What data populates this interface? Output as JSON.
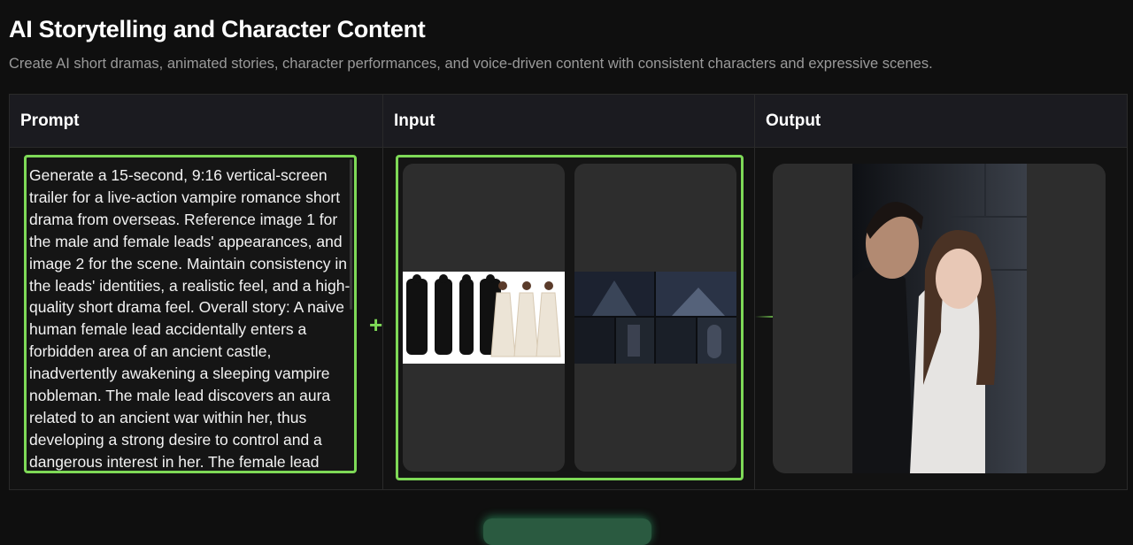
{
  "section": {
    "title": "AI Storytelling and Character Content",
    "subtitle": "Create AI short dramas, animated stories, character performances, and voice-driven content with consistent characters and expressive scenes."
  },
  "table": {
    "headers": [
      "Prompt",
      "Input",
      "Output"
    ],
    "prompt_text": "Generate a 15-second, 9:16 vertical-screen trailer for a live-action vampire romance short drama from overseas. Reference image 1 for the male and female leads' appearances, and image 2 for the scene. Maintain consistency in the leads' identities, a realistic feel, and a high-quality short drama feel. Overall story: A naive human female lead accidentally enters a forbidden area of an ancient castle, inadvertently awakening a sleeping vampire nobleman. The male lead discovers an aura related to an ancient war within her, thus developing a strong desire to control and a dangerous interest in her. The female lead",
    "plus_symbol": "+"
  },
  "icons": {
    "plus": "plus-icon",
    "arrow": "arrow-right-icon"
  },
  "colors": {
    "accent": "#7ed957",
    "background": "#0f0f0f",
    "header_bg": "#1b1b20",
    "card_bg": "#2d2d2d"
  }
}
